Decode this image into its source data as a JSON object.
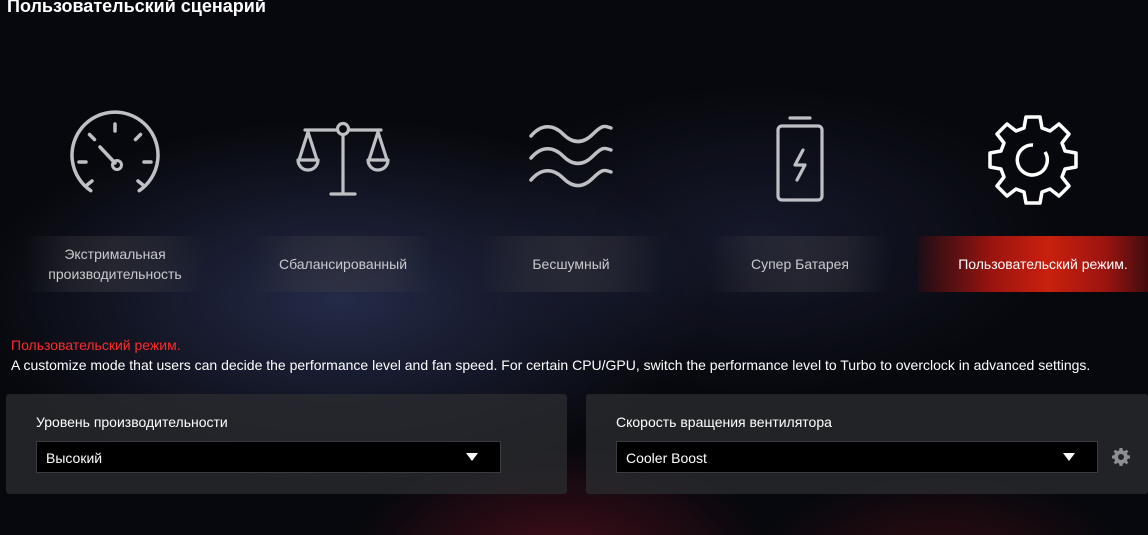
{
  "page_title": "Пользовательский сценарий",
  "modes": [
    {
      "label": "Экстримальная производительность",
      "icon": "speedometer-icon"
    },
    {
      "label": "Сбалансированный",
      "icon": "scales-icon"
    },
    {
      "label": "Бесшумный",
      "icon": "waves-icon"
    },
    {
      "label": "Супер Батарея",
      "icon": "battery-icon"
    },
    {
      "label": "Пользовательский режим.",
      "icon": "gear-icon",
      "active": true
    }
  ],
  "description": {
    "title": "Пользовательский режим.",
    "text": "A customize mode that users can decide the performance level and fan speed. For certain CPU/GPU, switch the performance level to Turbo to overclock in advanced settings."
  },
  "performance": {
    "label": "Уровень производительности",
    "value": "Высокий"
  },
  "fan": {
    "label": "Скорость вращения вентилятора",
    "value": "Cooler Boost",
    "settings_icon": "gear-icon"
  },
  "colors": {
    "accent": "#c9200e",
    "description_title": "#ff2a2a",
    "background": "#07080d"
  }
}
